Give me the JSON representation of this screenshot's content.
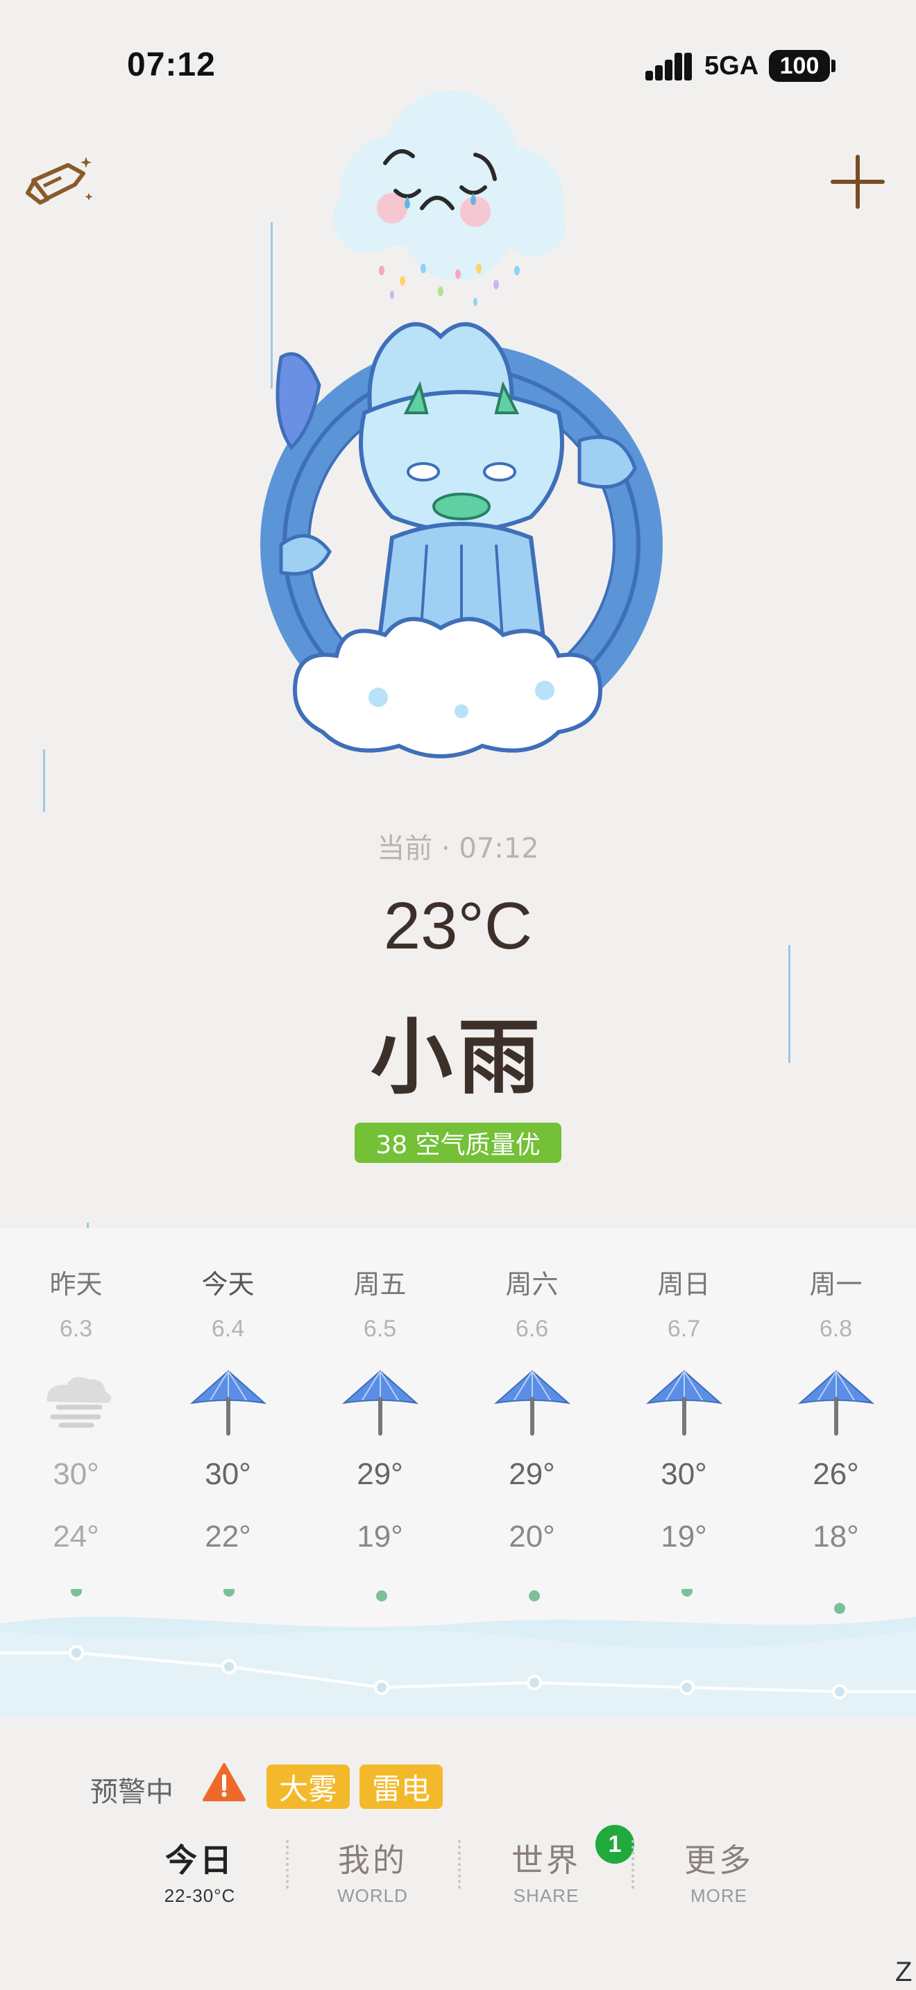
{
  "status_bar": {
    "time": "07:12",
    "network": "5GA",
    "battery": "100"
  },
  "current": {
    "label": "当前 · 07:12",
    "temperature": "23°C",
    "condition": "小雨",
    "aqi": "38 空气质量优",
    "aqi_color": "#74c037"
  },
  "forecast": [
    {
      "name": "昨天",
      "date": "6.3",
      "icon": "fog-icon",
      "high": "30°",
      "low": "24°"
    },
    {
      "name": "今天",
      "date": "6.4",
      "icon": "umbrella-icon",
      "high": "30°",
      "low": "22°"
    },
    {
      "name": "周五",
      "date": "6.5",
      "icon": "umbrella-icon",
      "high": "29°",
      "low": "19°"
    },
    {
      "name": "周六",
      "date": "6.6",
      "icon": "umbrella-icon",
      "high": "29°",
      "low": "20°"
    },
    {
      "name": "周日",
      "date": "6.7",
      "icon": "umbrella-icon",
      "high": "30°",
      "low": "19°"
    },
    {
      "name": "周一",
      "date": "6.8",
      "icon": "umbrella-icon",
      "high": "26°",
      "low": "18°"
    }
  ],
  "warnings": {
    "label": "预警中",
    "tags": [
      "大雾",
      "雷电"
    ],
    "tag_color": "#f4b92b"
  },
  "tabs": [
    {
      "label": "今日",
      "sub": "22-30°C"
    },
    {
      "label": "我的",
      "sub": "WORLD"
    },
    {
      "label": "世界",
      "sub": "SHARE"
    },
    {
      "label": "更多",
      "sub": "MORE"
    }
  ],
  "share_badge": "1",
  "corner_letter": "Z"
}
